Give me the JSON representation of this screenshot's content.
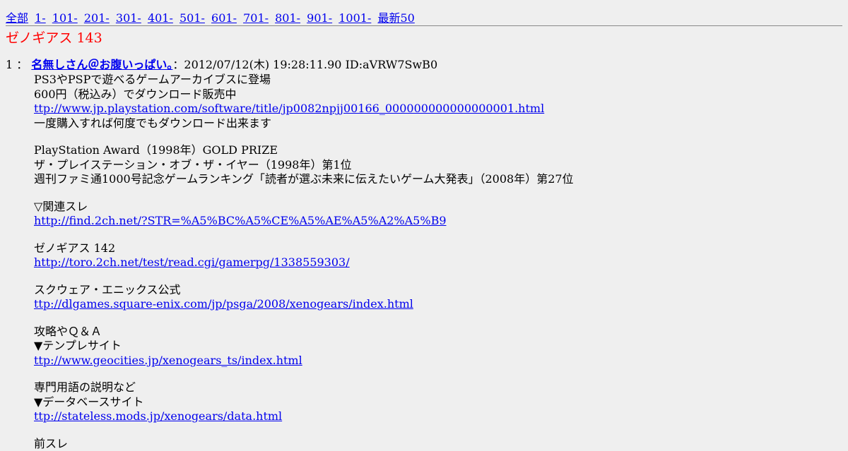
{
  "nav": [
    {
      "label": "全部"
    },
    {
      "label": "1-"
    },
    {
      "label": "101-"
    },
    {
      "label": "201-"
    },
    {
      "label": "301-"
    },
    {
      "label": "401-"
    },
    {
      "label": "501-"
    },
    {
      "label": "601-"
    },
    {
      "label": "701-"
    },
    {
      "label": "801-"
    },
    {
      "label": "901-"
    },
    {
      "label": "1001-"
    },
    {
      "label": "最新50"
    }
  ],
  "thread_title": "ゼノギアス 143",
  "post": {
    "number": "1",
    "sep": " ：",
    "name": "名無しさん＠お腹いっぱい。",
    "meta": "：2012/07/12(木) 19:28:11.90 ID:aVRW7SwB0"
  },
  "body": {
    "l1": "PS3やPSPで遊べるゲームアーカイブスに登場",
    "l2": "600円（税込み）でダウンロード販売中",
    "l3": "ttp://www.jp.playstation.com/software/title/jp0082npjj00166_000000000000000001.html",
    "l4": "一度購入すれば何度でもダウンロード出来ます",
    "l5": "PlayStation Award（1998年）GOLD PRIZE",
    "l6": "ザ・プレイステーション・オブ・ザ・イヤー（1998年）第1位",
    "l7": "週刊ファミ通1000号記念ゲームランキング「読者が選ぶ未来に伝えたいゲーム大発表」（2008年）第27位",
    "l8": "▽関連スレ",
    "l9": "http://find.2ch.net/?STR=%A5%BC%A5%CE%A5%AE%A5%A2%A5%B9",
    "l10": "ゼノギアス 142",
    "l11": "http://toro.2ch.net/test/read.cgi/gamerpg/1338559303/",
    "l12": "スクウェア・エニックス公式",
    "l13": "ttp://dlgames.square-enix.com/jp/psga/2008/xenogears/index.html",
    "l14": "攻略やＱ＆Ａ",
    "l15": "▼テンプレサイト",
    "l16": "ttp://www.geocities.jp/xenogears_ts/index.html",
    "l17": "専門用語の説明など",
    "l18": "▼データベースサイト",
    "l19": "ttp://stateless.mods.jp/xenogears/data.html",
    "l20": "前スレ"
  }
}
